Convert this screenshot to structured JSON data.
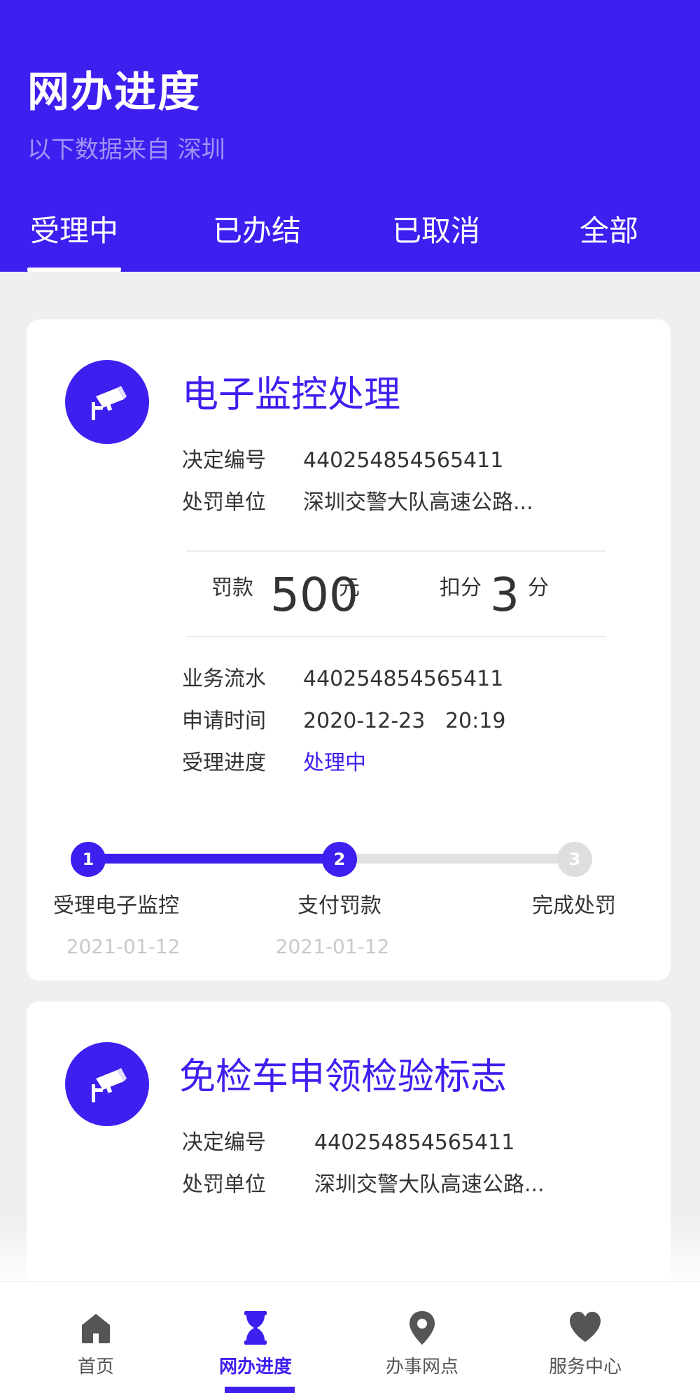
{
  "header": {
    "title": "网办进度",
    "subtitle": "以下数据来自 深圳",
    "tabs": [
      {
        "label": "受理中",
        "active": true
      },
      {
        "label": "已办结",
        "active": false
      },
      {
        "label": "已取消",
        "active": false
      },
      {
        "label": "全部",
        "active": false
      }
    ]
  },
  "colors": {
    "accent": "#3d1ff0",
    "background": "#efefef",
    "muted": "#c9c9c9"
  },
  "cards": [
    {
      "icon": "cctv-camera-icon",
      "title": "电子监控处理",
      "decision_no_label": "决定编号",
      "decision_no": "440254854565411",
      "unit_label": "处罚单位",
      "unit": "深圳交警大队高速公路...",
      "fine_label": "罚款",
      "fine_amount": "500",
      "fine_unit": "元",
      "points_label": "扣分",
      "points": "3",
      "points_unit": "分",
      "serial_label": "业务流水",
      "serial": "440254854565411",
      "apply_time_label": "申请时间",
      "apply_time": "2020-12-23   20:19",
      "status_label": "受理进度",
      "status": "处理中",
      "steps": [
        {
          "number": "1",
          "label": "受理电子监控",
          "date": "2021-01-12",
          "done": true
        },
        {
          "number": "2",
          "label": "支付罚款",
          "date": "2021-01-12",
          "done": true
        },
        {
          "number": "3",
          "label": "完成处罚",
          "date": "",
          "done": false
        }
      ]
    },
    {
      "icon": "cctv-camera-icon",
      "title": "免检车申领检验标志",
      "decision_no_label": "决定编号",
      "decision_no": "440254854565411",
      "unit_label": "处罚单位",
      "unit": "深圳交警大队高速公路..."
    }
  ],
  "bottom_nav": [
    {
      "label": "首页",
      "icon": "home-icon",
      "active": false
    },
    {
      "label": "网办进度",
      "icon": "hourglass-icon",
      "active": true
    },
    {
      "label": "办事网点",
      "icon": "location-pin-icon",
      "active": false
    },
    {
      "label": "服务中心",
      "icon": "heart-icon",
      "active": false
    }
  ]
}
